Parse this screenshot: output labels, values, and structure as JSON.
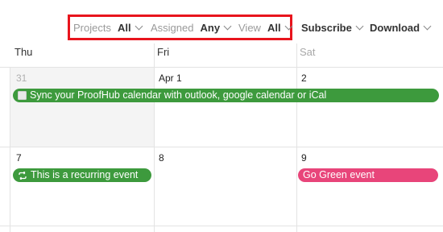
{
  "toolbar": {
    "projects_label": "Projects",
    "projects_value": "All",
    "assigned_label": "Assigned",
    "assigned_value": "Any",
    "view_label": "View",
    "view_value": "All",
    "subscribe_label": "Subscribe",
    "download_label": "Download",
    "highlight_color": "#e8141d"
  },
  "days": [
    {
      "name": "Thu"
    },
    {
      "name": "Fri"
    },
    {
      "name": "Sat",
      "muted": true
    }
  ],
  "week1": {
    "dates": [
      "31",
      "Apr 1",
      "2"
    ],
    "events": [
      {
        "label": "Sync your ProofHub calendar with outlook, google calendar or iCal",
        "icon": "checkbox-icon",
        "color": "#3d9a3d"
      }
    ]
  },
  "week2": {
    "dates": [
      "7",
      "8",
      "9"
    ],
    "events": [
      {
        "label": "This is a recurring event",
        "icon": "recurring-icon",
        "color": "#3d9a3d"
      },
      {
        "label": "Go Green event",
        "color": "#e8457a"
      }
    ]
  }
}
